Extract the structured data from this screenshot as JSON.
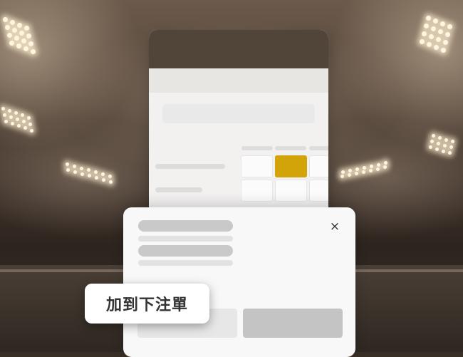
{
  "add_to_betslip": {
    "label": "加到下注單"
  },
  "betslip": {
    "close_symbol": "×"
  },
  "colors": {
    "accent": "#d3a40a",
    "header": "#514439"
  }
}
